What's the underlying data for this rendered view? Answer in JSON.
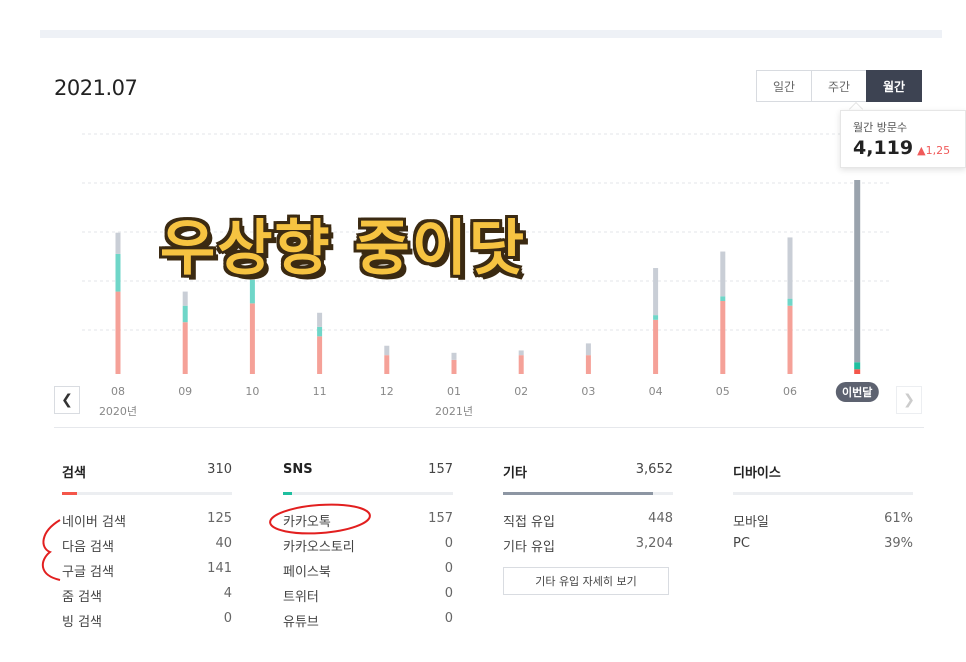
{
  "period": "2021.07",
  "tabs": [
    {
      "label": "일간",
      "active": false
    },
    {
      "label": "주간",
      "active": false
    },
    {
      "label": "월간",
      "active": true
    }
  ],
  "tooltip": {
    "label": "월간 방문수",
    "value": "4,119",
    "delta": "▲1,25"
  },
  "overlay_text": "우상향 중이닷",
  "colors": {
    "search": "#f5a198",
    "sns": "#6fd6c8",
    "other": "#c9ced6",
    "current_other": "#9aa3ad",
    "current_search": "#f4564a",
    "current_sns": "#1fbf9f"
  },
  "x_axis": {
    "months": [
      "08",
      "09",
      "10",
      "11",
      "12",
      "01",
      "02",
      "03",
      "04",
      "05",
      "06",
      "이번달"
    ],
    "years": [
      {
        "label": "2020년",
        "at": 0
      },
      {
        "label": "2021년",
        "at": 5
      }
    ]
  },
  "chart_data": {
    "type": "bar",
    "stacked": true,
    "categories": [
      "08",
      "09",
      "10",
      "11",
      "12",
      "01",
      "02",
      "03",
      "04",
      "05",
      "06",
      "이번달"
    ],
    "series": [
      {
        "name": "검색",
        "values": [
          1750,
          1100,
          1500,
          800,
          400,
          300,
          400,
          400,
          1150,
          1550,
          1450,
          100
        ]
      },
      {
        "name": "SNS",
        "values": [
          800,
          350,
          500,
          200,
          0,
          0,
          0,
          0,
          100,
          100,
          150,
          150
        ]
      },
      {
        "name": "기타",
        "values": [
          450,
          300,
          300,
          300,
          200,
          150,
          100,
          250,
          1000,
          950,
          1300,
          3869
        ]
      }
    ],
    "ylim": [
      0,
      4119
    ]
  },
  "panels": {
    "search": {
      "title": "검색",
      "count": "310",
      "fill_ratio": 0.09,
      "rows": [
        {
          "name": "네이버 검색",
          "value": "125"
        },
        {
          "name": "다음 검색",
          "value": "40"
        },
        {
          "name": "구글 검색",
          "value": "141"
        },
        {
          "name": "줌 검색",
          "value": "4"
        },
        {
          "name": "빙 검색",
          "value": "0"
        }
      ]
    },
    "sns": {
      "title": "SNS",
      "count": "157",
      "fill_ratio": 0.05,
      "rows": [
        {
          "name": "카카오톡",
          "value": "157"
        },
        {
          "name": "카카오스토리",
          "value": "0"
        },
        {
          "name": "페이스북",
          "value": "0"
        },
        {
          "name": "트위터",
          "value": "0"
        },
        {
          "name": "유튜브",
          "value": "0"
        }
      ]
    },
    "other": {
      "title": "기타",
      "count": "3,652",
      "fill_ratio": 0.88,
      "rows": [
        {
          "name": "직접 유입",
          "value": "448"
        },
        {
          "name": "기타 유입",
          "value": "3,204"
        }
      ],
      "button": "기타 유입 자세히 보기"
    },
    "device": {
      "title": "디바이스",
      "rows": [
        {
          "name": "모바일",
          "value": "61%"
        },
        {
          "name": "PC",
          "value": "39%"
        }
      ]
    }
  }
}
